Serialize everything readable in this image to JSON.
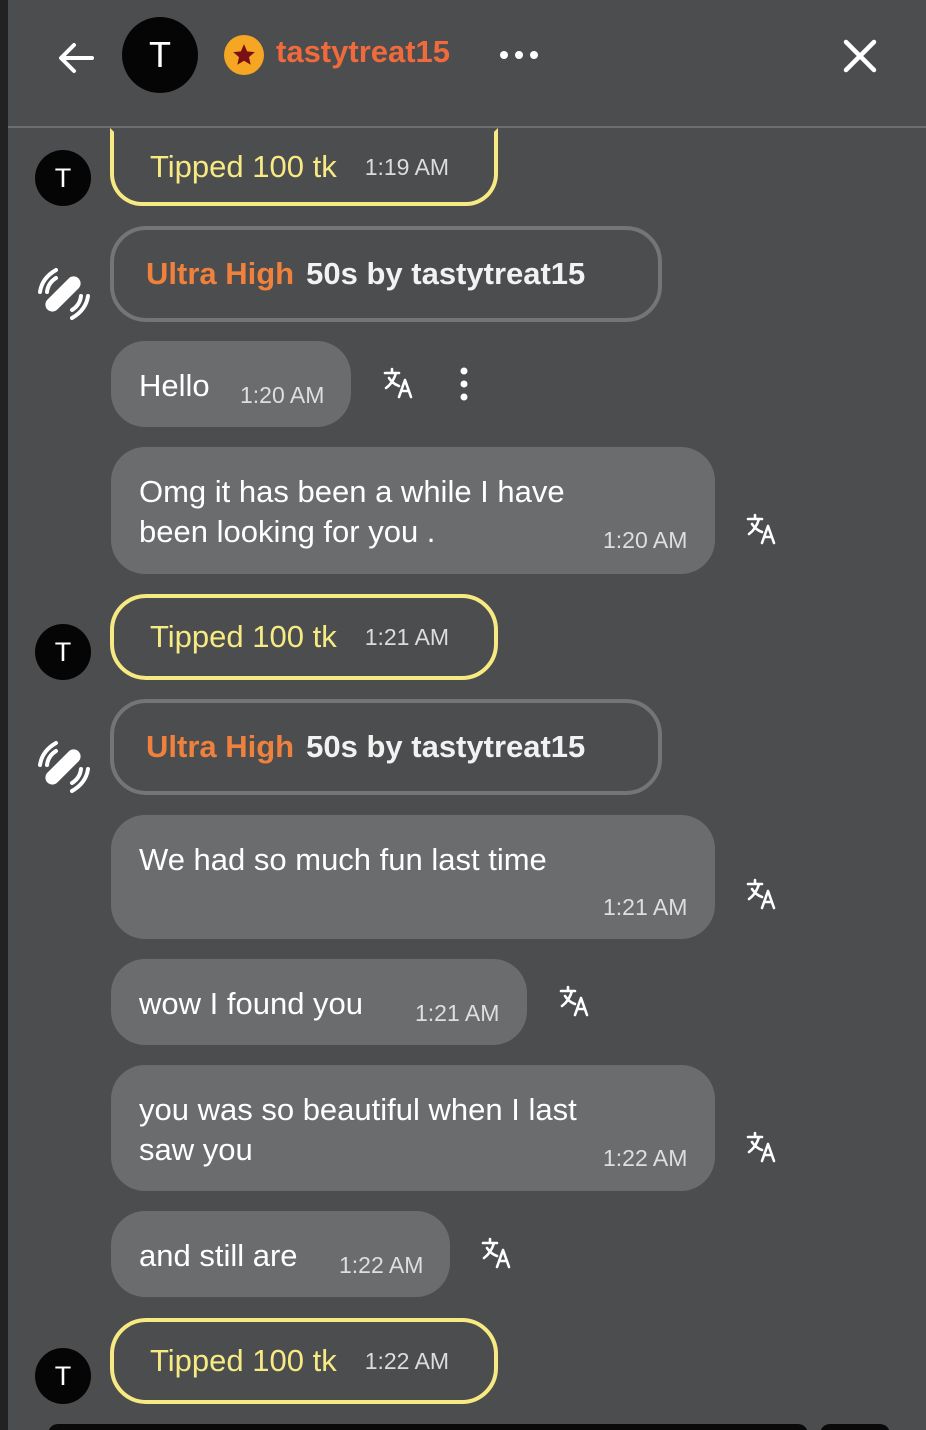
{
  "header": {
    "avatar_letter": "T",
    "username": "tastytreat15",
    "icons": [
      "back-arrow-icon",
      "star-badge-icon",
      "more-dots-icon",
      "close-icon"
    ]
  },
  "colors": {
    "background": "#4c4d4f",
    "bubble": "#6b6c6e",
    "tip_border": "#f7ea82",
    "username": "#f06a3c",
    "ultra_level": "#f0813c"
  },
  "messages": {
    "tip1": {
      "avatar": "T",
      "text": "Tipped 100 tk",
      "time": "1:19 AM"
    },
    "ultra1": {
      "level": "Ultra High",
      "rest": "50s by tastytreat15"
    },
    "m1": {
      "text": "Hello",
      "time": "1:20 AM"
    },
    "m2": {
      "line1": "Omg it has been a while I have",
      "line2": "been looking for you .",
      "time": "1:20 AM"
    },
    "tip2": {
      "avatar": "T",
      "text": "Tipped 100 tk",
      "time": "1:21 AM"
    },
    "ultra2": {
      "level": "Ultra High",
      "rest": "50s by tastytreat15"
    },
    "m3": {
      "text": "We had so much fun last time",
      "time": "1:21 AM"
    },
    "m4": {
      "text": "wow I found you",
      "time": "1:21 AM"
    },
    "m5": {
      "line1": "you was so beautiful when I last",
      "line2": "saw you",
      "time": "1:22 AM"
    },
    "m6": {
      "text": "and still are",
      "time": "1:22 AM"
    },
    "tip3": {
      "avatar": "T",
      "text": "Tipped 100 tk",
      "time": "1:22 AM"
    }
  }
}
